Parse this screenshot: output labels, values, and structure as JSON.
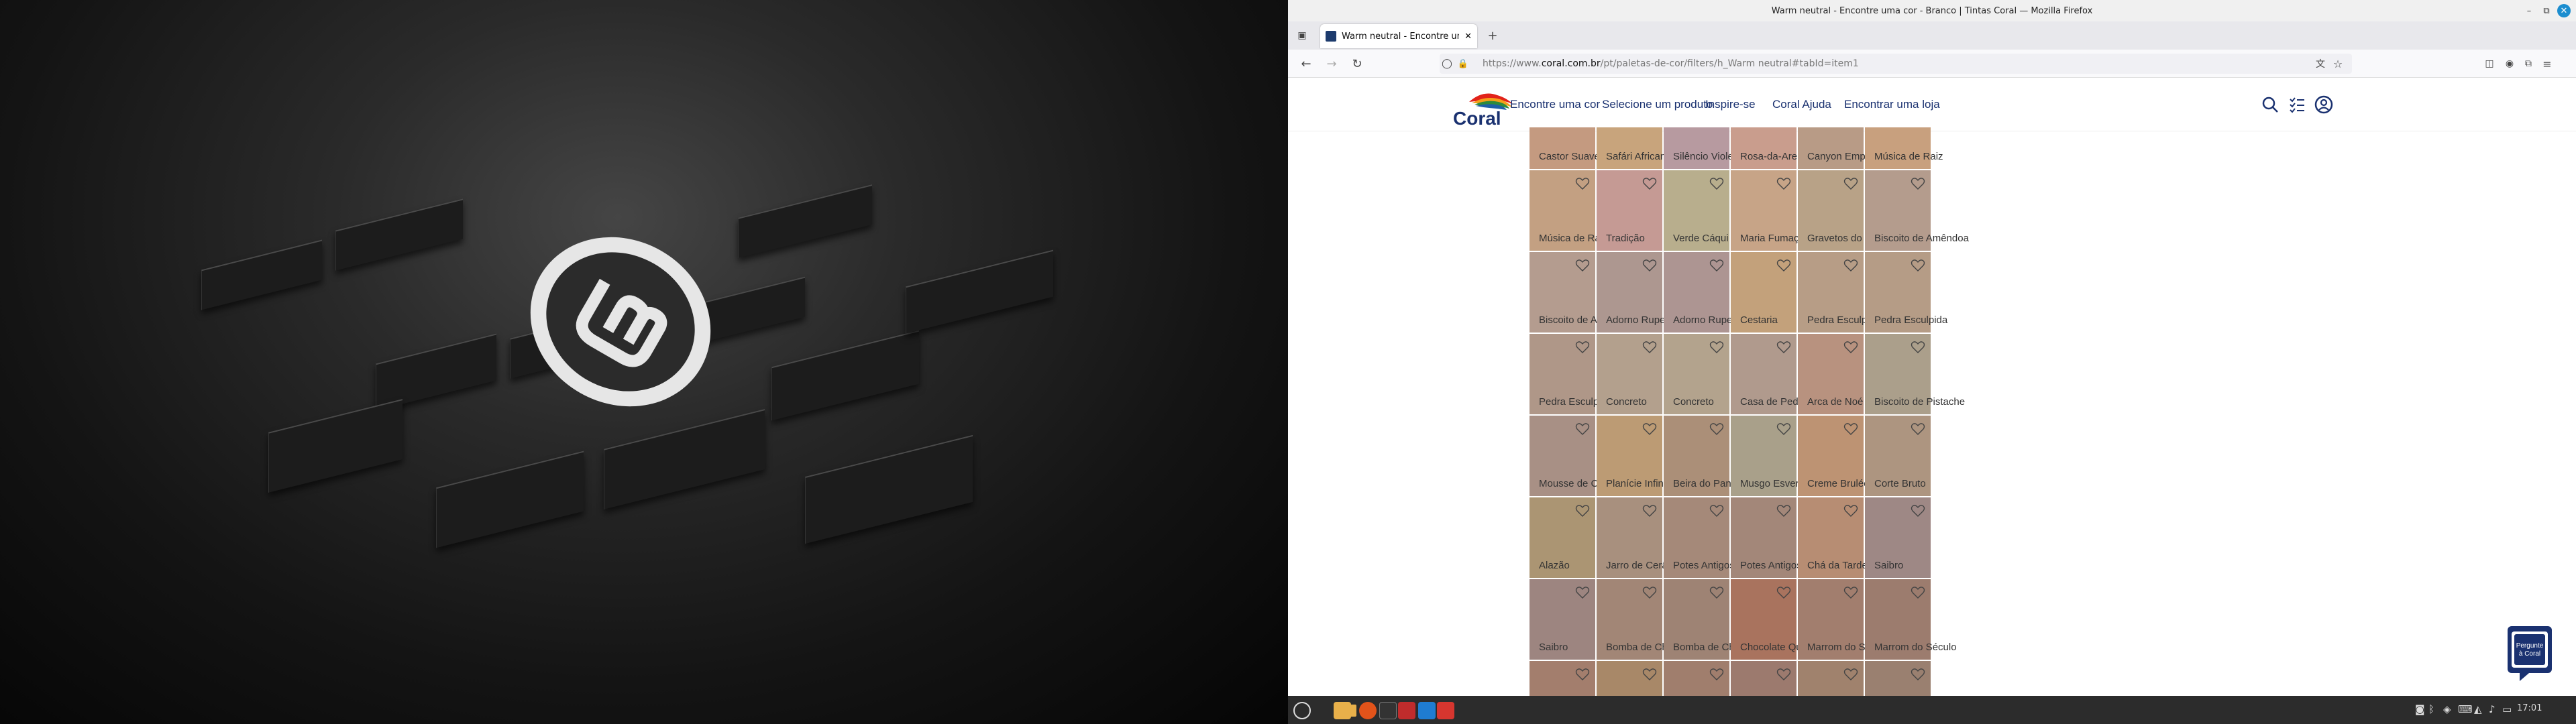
{
  "window": {
    "title": "Warm neutral - Encontre uma cor - Branco | Tintas Coral — Mozilla Firefox",
    "controls": [
      "–",
      "⧉",
      "✕"
    ]
  },
  "tab": {
    "title": "Warm neutral - Encontre uma cor"
  },
  "url": {
    "prefix": "https://www.",
    "host": "coral.com.br",
    "path": "/pt/paletas-de-cor/filters/h_Warm neutral#tabId=item1"
  },
  "site": {
    "logo_text": "Coral",
    "nav": [
      "Encontre uma cor",
      "Selecione um produto",
      "Inspire-se",
      "Coral Ajuda",
      "Encontrar uma loja"
    ]
  },
  "swatches": [
    [
      {
        "name": "Castor Suave",
        "color": "#c49a80"
      },
      {
        "name": "Safári Africano",
        "color": "#c8a47c"
      },
      {
        "name": "Silêncio Violeta",
        "color": "#b79aa0"
      },
      {
        "name": "Rosa-da-Areia",
        "color": "#c99d8d"
      },
      {
        "name": "Canyon Empoeirado",
        "color": "#b89b86"
      },
      {
        "name": "Música de Raiz",
        "color": "#c8a07e"
      }
    ],
    [
      {
        "name": "Música de Raiz",
        "color": "#c3a082"
      },
      {
        "name": "Tradição",
        "color": "#c59a94"
      },
      {
        "name": "Verde Cáqui",
        "color": "#b8ae8d"
      },
      {
        "name": "Maria Fumaça",
        "color": "#c7a487"
      },
      {
        "name": "Gravetos do Matagal",
        "color": "#b8a287"
      },
      {
        "name": "Biscoito de Amêndoa",
        "color": "#b49c8d"
      }
    ],
    [
      {
        "name": "Biscoito de Amêndoa",
        "color": "#b49c8f"
      },
      {
        "name": "Adorno Rupestre",
        "color": "#ad9790"
      },
      {
        "name": "Adorno Rupestre",
        "color": "#ad9592"
      },
      {
        "name": "Cestaria",
        "color": "#c3a17b"
      },
      {
        "name": "Pedra Esculpida",
        "color": "#b79d86"
      },
      {
        "name": "Pedra Esculpida",
        "color": "#b59c86"
      }
    ],
    [
      {
        "name": "Pedra Esculpida",
        "color": "#af9788"
      },
      {
        "name": "Concreto",
        "color": "#b3a08d"
      },
      {
        "name": "Concreto",
        "color": "#b3a38d"
      },
      {
        "name": "Casa de Pedra",
        "color": "#b09a8d"
      },
      {
        "name": "Arca de Noé",
        "color": "#b8927f"
      },
      {
        "name": "Biscoito de Pistache",
        "color": "#ab9f8b"
      }
    ],
    [
      {
        "name": "Mousse de Café",
        "color": "#a89085"
      },
      {
        "name": "Planície Infinita",
        "color": "#bc9b74"
      },
      {
        "name": "Beira do Pantanal",
        "color": "#ab8f78"
      },
      {
        "name": "Musgo Esverdeado",
        "color": "#a9a08a"
      },
      {
        "name": "Creme Brulée",
        "color": "#bd9373"
      },
      {
        "name": "Corte Bruto",
        "color": "#ad9580"
      }
    ],
    [
      {
        "name": "Alazão",
        "color": "#ab9573"
      },
      {
        "name": "Jarro de Cerâmica",
        "color": "#a8907e"
      },
      {
        "name": "Potes Antigos",
        "color": "#a58979"
      },
      {
        "name": "Potes Antigos",
        "color": "#a38779"
      },
      {
        "name": "Chá da Tarde",
        "color": "#b78d73"
      },
      {
        "name": "Saibro",
        "color": "#9e8885"
      }
    ],
    [
      {
        "name": "Saibro",
        "color": "#9d8580"
      },
      {
        "name": "Bomba de Chocolate",
        "color": "#a28676"
      },
      {
        "name": "Bomba de Chocolate",
        "color": "#9e8374"
      },
      {
        "name": "Chocolate Quente",
        "color": "#a9735e"
      },
      {
        "name": "Marrom do Século",
        "color": "#a27e6e"
      },
      {
        "name": "Marrom do Século",
        "color": "#9c7c6e"
      }
    ],
    [
      {
        "name": "",
        "color": "#a37e6d"
      },
      {
        "name": "",
        "color": "#a88868"
      },
      {
        "name": "",
        "color": "#a07e6d"
      },
      {
        "name": "",
        "color": "#9c7a6e"
      },
      {
        "name": "",
        "color": "#a0826d"
      },
      {
        "name": "",
        "color": "#9a8070"
      }
    ]
  ],
  "chat": {
    "line1": "Pergunte",
    "line2": "à Coral"
  },
  "taskbar": {
    "clock": "17:01"
  },
  "colors": {
    "brand": "#1a3170",
    "accent_red": "#e2231a"
  }
}
